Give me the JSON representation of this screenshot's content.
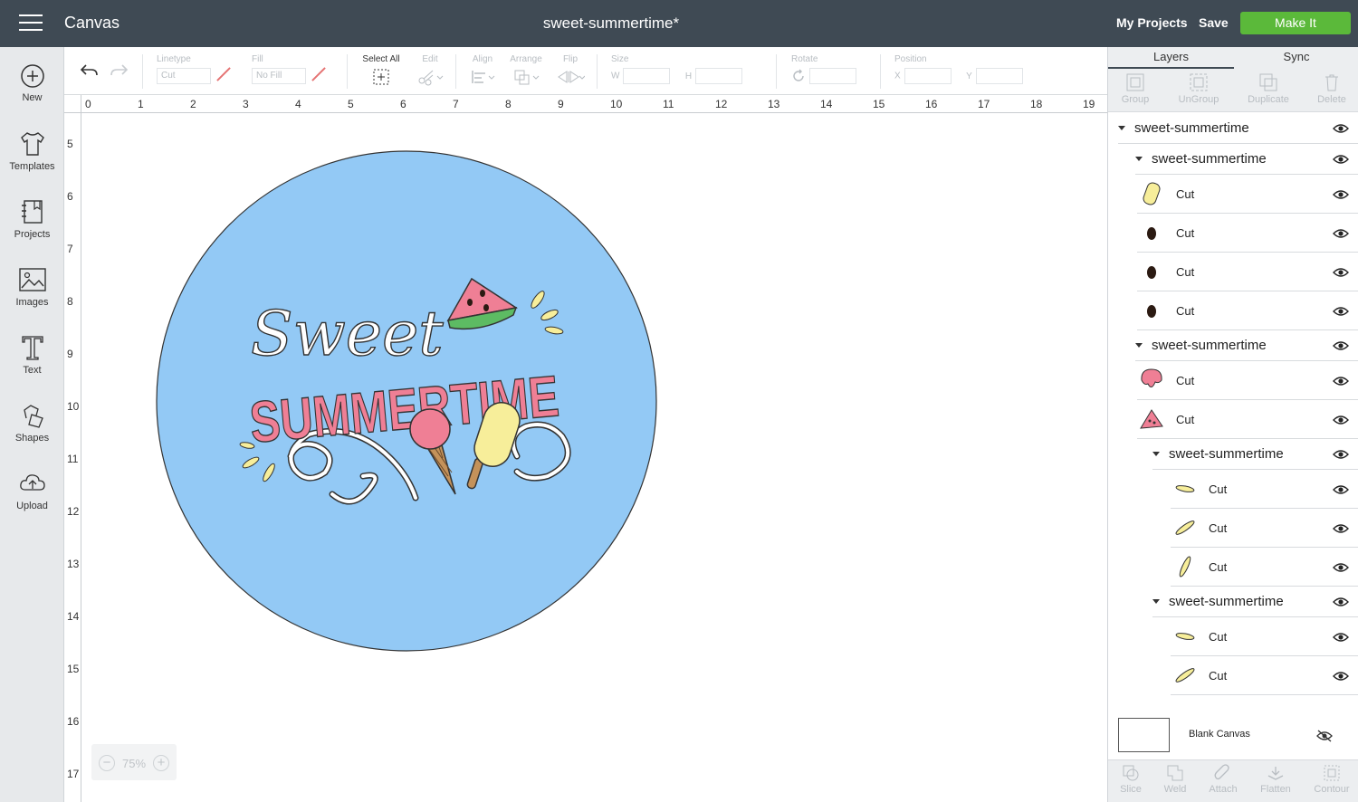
{
  "topbar": {
    "app_title": "Canvas",
    "doc_title": "sweet-summertime*",
    "my_projects": "My Projects",
    "save": "Save",
    "make_it": "Make It"
  },
  "leftbar": {
    "items": [
      {
        "label": "New",
        "icon": "plus-circle-icon"
      },
      {
        "label": "Templates",
        "icon": "tshirt-icon"
      },
      {
        "label": "Projects",
        "icon": "projects-icon"
      },
      {
        "label": "Images",
        "icon": "image-icon"
      },
      {
        "label": "Text",
        "icon": "text-icon"
      },
      {
        "label": "Shapes",
        "icon": "shapes-icon"
      },
      {
        "label": "Upload",
        "icon": "upload-cloud-icon"
      }
    ]
  },
  "toolbar": {
    "linetype_label": "Linetype",
    "linetype_value": "Cut",
    "fill_label": "Fill",
    "fill_value": "No Fill",
    "select_all": "Select All",
    "edit": "Edit",
    "align": "Align",
    "arrange": "Arrange",
    "flip": "Flip",
    "size": "Size",
    "size_w": "W",
    "size_h": "H",
    "rotate": "Rotate",
    "position": "Position",
    "pos_x": "X",
    "pos_y": "Y"
  },
  "ruler": {
    "top": [
      "0",
      "1",
      "2",
      "3",
      "4",
      "5",
      "6",
      "7",
      "8",
      "9",
      "10",
      "11",
      "12",
      "13",
      "14",
      "15",
      "16",
      "17",
      "18",
      "19"
    ],
    "left": [
      "5",
      "6",
      "7",
      "8",
      "9",
      "10",
      "11",
      "12",
      "13",
      "14",
      "15",
      "16",
      "17"
    ]
  },
  "canvas": {
    "circle_color": "#93c9f5",
    "design_word_1": "Sweet",
    "design_word_2": "SUMMERTIME",
    "zoom_minus": "−",
    "zoom_value": "75%",
    "zoom_plus": "+"
  },
  "panel": {
    "tab_layers": "Layers",
    "tab_sync": "Sync",
    "tools": [
      "Group",
      "UnGroup",
      "Duplicate",
      "Delete"
    ],
    "layers": [
      {
        "kind": "group",
        "label": "sweet-summertime",
        "depth": 0
      },
      {
        "kind": "group",
        "label": "sweet-summertime",
        "depth": 1
      },
      {
        "kind": "item",
        "label": "Cut",
        "depth": 1,
        "thumb": "popsicle",
        "color": "#f7ee9a"
      },
      {
        "kind": "item",
        "label": "Cut",
        "depth": 1,
        "thumb": "seed",
        "color": "#2b1a12"
      },
      {
        "kind": "item",
        "label": "Cut",
        "depth": 1,
        "thumb": "seed",
        "color": "#2b1a12"
      },
      {
        "kind": "item",
        "label": "Cut",
        "depth": 1,
        "thumb": "seed",
        "color": "#2b1a12"
      },
      {
        "kind": "group",
        "label": "sweet-summertime",
        "depth": 1
      },
      {
        "kind": "item",
        "label": "Cut",
        "depth": 1,
        "thumb": "scoop",
        "color": "#ef7f95"
      },
      {
        "kind": "item",
        "label": "Cut",
        "depth": 1,
        "thumb": "watermelon",
        "color": "#ef7f95"
      },
      {
        "kind": "group",
        "label": "sweet-summertime",
        "depth": 2
      },
      {
        "kind": "item",
        "label": "Cut",
        "depth": 2,
        "thumb": "splash1",
        "color": "#f7ee9a"
      },
      {
        "kind": "item",
        "label": "Cut",
        "depth": 2,
        "thumb": "splash2",
        "color": "#f7ee9a"
      },
      {
        "kind": "item",
        "label": "Cut",
        "depth": 2,
        "thumb": "splash3",
        "color": "#f7ee9a"
      },
      {
        "kind": "group",
        "label": "sweet-summertime",
        "depth": 2
      },
      {
        "kind": "item",
        "label": "Cut",
        "depth": 2,
        "thumb": "splash1",
        "color": "#f7ee9a"
      },
      {
        "kind": "item",
        "label": "Cut",
        "depth": 2,
        "thumb": "splash2",
        "color": "#f7ee9a"
      }
    ],
    "blank_canvas": "Blank Canvas",
    "bottom_tools": [
      "Slice",
      "Weld",
      "Attach",
      "Flatten",
      "Contour"
    ]
  },
  "colors": {
    "topbar": "#3f4a54",
    "make_it": "#5bb93a",
    "pink": "#ef7f95",
    "yellow": "#f7ee9a",
    "sky": "#93c9f5"
  }
}
